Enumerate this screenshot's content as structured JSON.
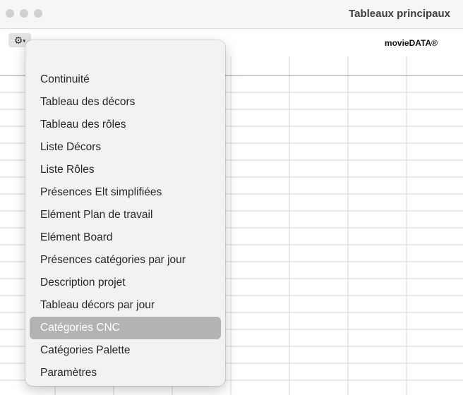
{
  "window": {
    "title": "Tableaux principaux"
  },
  "toolbar": {
    "gear_icon": "gear-icon",
    "brand": "movieDATA®"
  },
  "menu": {
    "selected_index": 11,
    "items": [
      {
        "label": "Continuité"
      },
      {
        "label": "Tableau des décors"
      },
      {
        "label": "Tableau des rôles"
      },
      {
        "label": "Liste Décors"
      },
      {
        "label": "Liste Rôles"
      },
      {
        "label": "Présences Elt simplifiées"
      },
      {
        "label": "Elément Plan de travail"
      },
      {
        "label": "Elément Board"
      },
      {
        "label": "Présences catégories par jour"
      },
      {
        "label": "Description projet"
      },
      {
        "label": "Tableau décors par jour"
      },
      {
        "label": "Catégories CNC"
      },
      {
        "label": "Catégories Palette"
      },
      {
        "label": "Paramètres"
      }
    ]
  },
  "colors": {
    "menu_background": "#f2f2f2",
    "selected_background": "#b3b3b3",
    "grid_line": "#d4d4d4"
  }
}
